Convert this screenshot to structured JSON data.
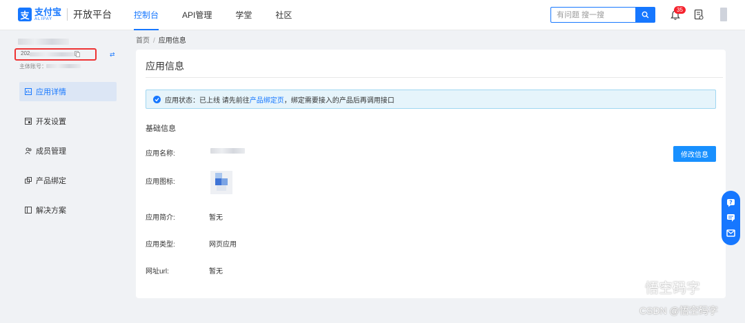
{
  "header": {
    "logo_cn": "支付宝",
    "logo_en": "ALIPAY",
    "platform": "开放平台",
    "nav": [
      "控制台",
      "API管理",
      "学堂",
      "社区"
    ],
    "search_placeholder": "有问题 搜一搜",
    "notification_count": "35"
  },
  "sidebar": {
    "account_id_prefix": "202",
    "subject_label": "主体账号：",
    "menu": [
      "应用详情",
      "开发设置",
      "成员管理",
      "产品绑定",
      "解决方案"
    ]
  },
  "breadcrumb": {
    "home": "首页",
    "sep": "/",
    "current": "应用信息"
  },
  "card": {
    "title": "应用信息",
    "alert": {
      "prefix": "应用状态：已上线 请先前往",
      "link": "产品绑定页",
      "suffix": "，绑定需要接入的产品后再调用接口"
    },
    "section_title": "基础信息",
    "fields": {
      "name_label": "应用名称:",
      "icon_label": "应用图标:",
      "intro_label": "应用简介:",
      "intro_value": "暂无",
      "type_label": "应用类型:",
      "type_value": "网页应用",
      "url_label": "网址url:",
      "url_value": "暂无"
    },
    "edit_button": "修改信息"
  },
  "watermark": {
    "line1": "悟空码字",
    "line2": "CSDN @悟空码字"
  },
  "colors": {
    "primary": "#1677ff",
    "alert_bg": "#e6f4fb",
    "highlight_box": "#e33333"
  }
}
